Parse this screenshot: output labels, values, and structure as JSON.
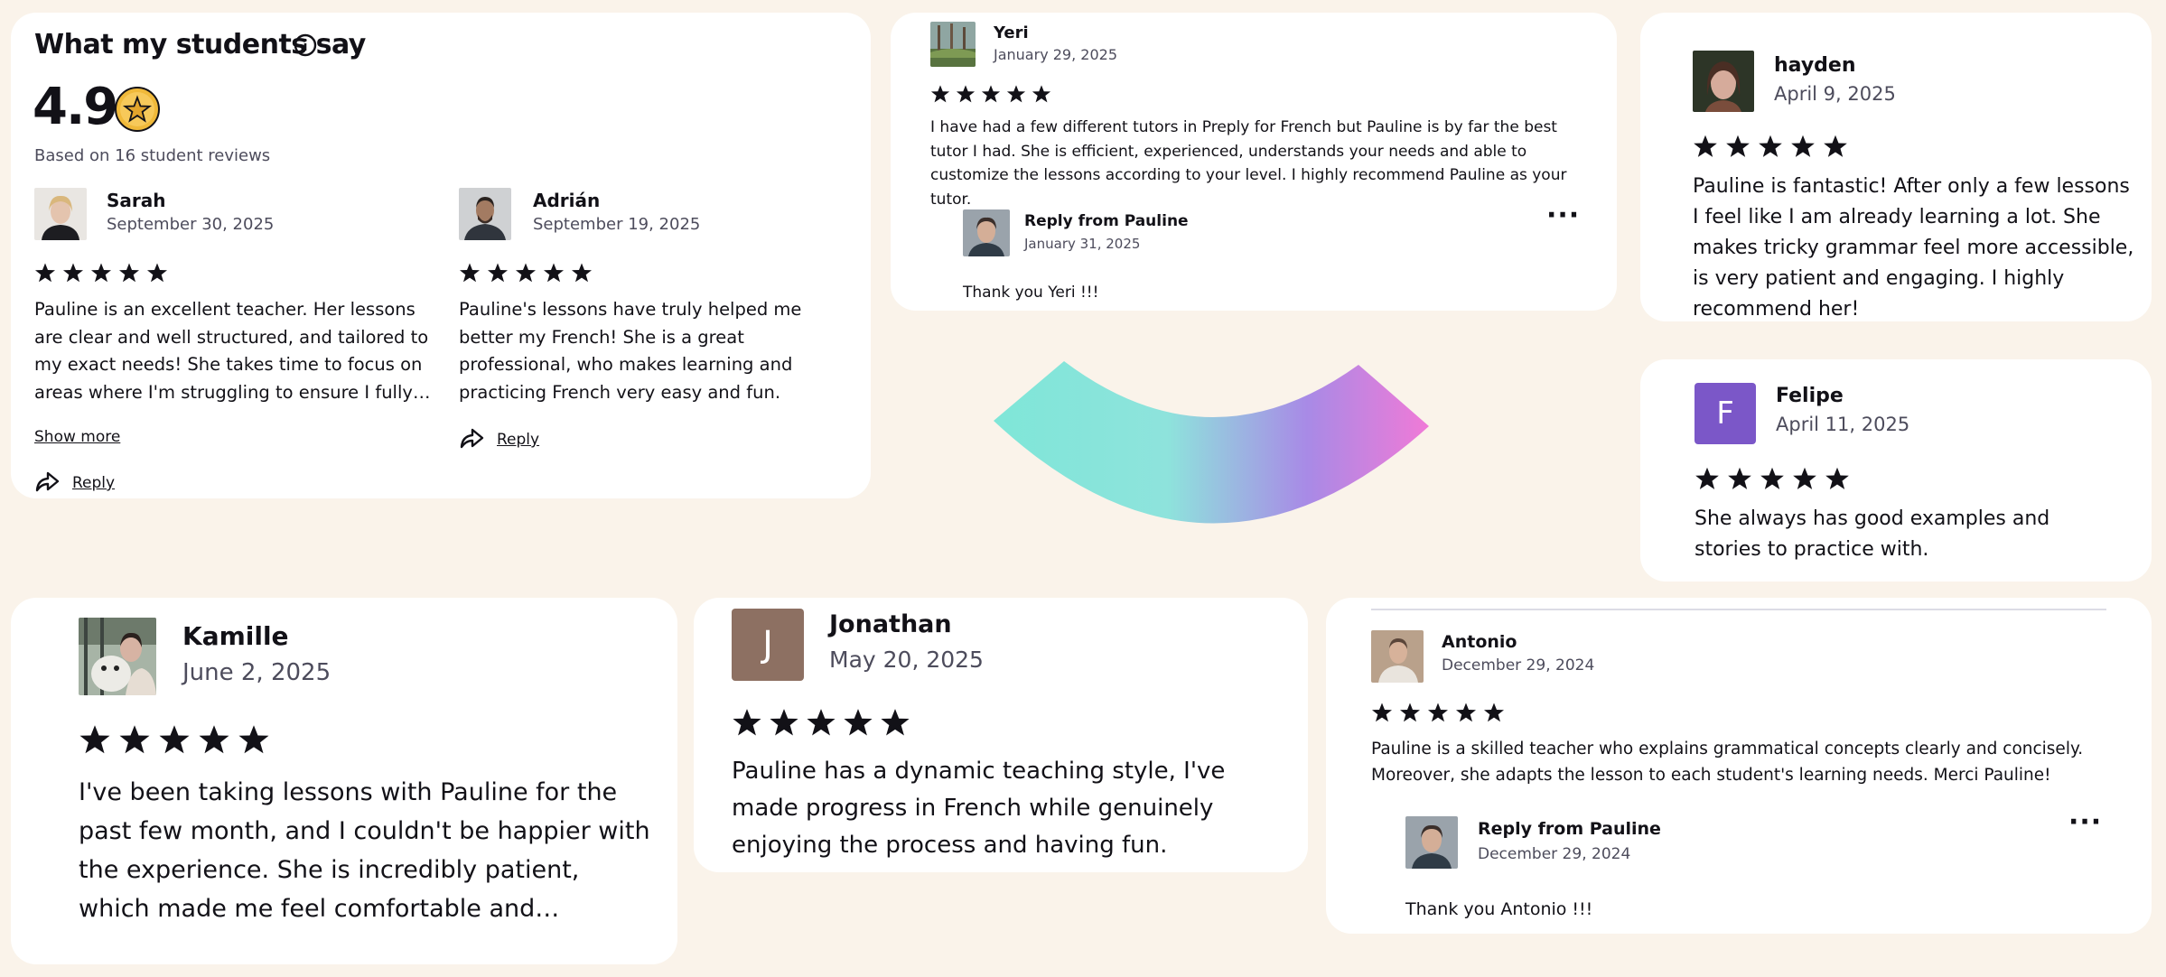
{
  "summary": {
    "title": "What my students say",
    "rating": "4.9",
    "based_on": "Based on 16 student reviews",
    "reply_label": "Reply",
    "show_more_label": "Show more"
  },
  "reviews": {
    "sarah": {
      "name": "Sarah",
      "date": "September 30, 2025",
      "stars": 5,
      "text": "Pauline is an excellent teacher. Her lessons are clear and well structured, and tailored to my exact needs! She takes time to focus on areas where I'm struggling to ensure I fully understand."
    },
    "adrian": {
      "name": "Adrián",
      "date": "September 19, 2025",
      "stars": 5,
      "text": "Pauline's lessons have truly helped me better my French! She is a great professional, who makes learning and practicing French very easy and fun.",
      "reply_label": "Reply"
    },
    "yeri": {
      "name": "Yeri",
      "date": "January 29, 2025",
      "stars": 5,
      "text": "I have had a few different tutors in Preply for French but Pauline is by far the best tutor I had. She is efficient, experienced, understands your needs and able to customize the lessons according to your level. I highly recommend Pauline as your tutor.",
      "reply_title": "Reply from Pauline",
      "reply_date": "January 31, 2025",
      "reply_text": "Thank you Yeri !!!"
    },
    "hayden": {
      "name": "hayden",
      "date": "April 9, 2025",
      "stars": 5,
      "text": "Pauline is fantastic! After only a few lessons I feel like I am already learning a lot. She makes tricky grammar feel more accessible, is very patient and engaging. I highly recommend her!"
    },
    "felipe": {
      "name": "Felipe",
      "initial": "F",
      "date": "April 11, 2025",
      "stars": 5,
      "text": "She always has good examples and stories to practice with."
    },
    "kamille": {
      "name": "Kamille",
      "date": "June 2, 2025",
      "stars": 5,
      "text": "I've been taking lessons with Pauline for the past few month, and I couldn't be happier with the experience. She is incredibly patient, which made me feel comfortable and confident even when making mistakes."
    },
    "jonathan": {
      "name": "Jonathan",
      "initial": "J",
      "date": "May 20, 2025",
      "stars": 5,
      "text": "Pauline has a dynamic teaching style, I've made progress in French while genuinely enjoying the process and having fun."
    },
    "antonio": {
      "name": "Antonio",
      "date": "December 29, 2024",
      "stars": 5,
      "text": "Pauline is a skilled teacher who explains grammatical concepts clearly and concisely. Moreover, she adapts the lesson to each student's learning needs. Merci Pauline!",
      "reply_title": "Reply from Pauline",
      "reply_date": "December 29, 2024",
      "reply_text": "Thank you Antonio !!!"
    }
  },
  "colors": {
    "background": "#faf3ea",
    "star": "#121117",
    "felipe_avatar": "#7b57c8",
    "jonathan_avatar": "#8d7062",
    "arc_gradient": [
      "#7fe4d8",
      "#a88ae6",
      "#ee7dd8"
    ],
    "rating_badge": "#f0b93a"
  },
  "icons": [
    "info-icon",
    "star-badge-icon",
    "star-icon",
    "reply-arrow-icon",
    "more-options-icon"
  ]
}
